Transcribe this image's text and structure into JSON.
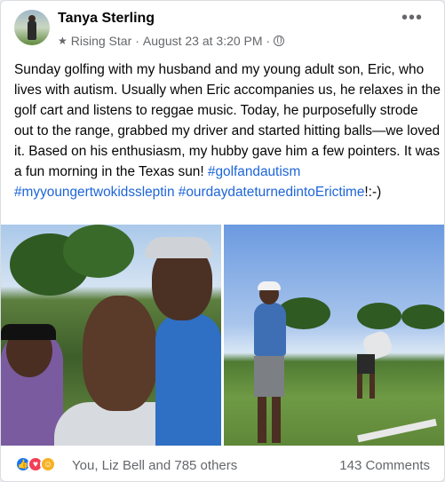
{
  "post": {
    "author": "Tanya Sterling",
    "badge": "Rising Star",
    "timestamp": "August 23 at 3:20 PM",
    "more_label": "•••",
    "body": "Sunday golfing with my husband and my young adult son, Eric, who lives with autism.  Usually when Eric accompanies us, he relaxes in the golf cart and listens to reggae music.  Today, he purposefully strode out to the range, grabbed my driver and started hitting balls—we loved it.  Based on his enthusiasm, my hubby gave him a few pointers.  It was a fun morning in the Texas sun!",
    "hashtags": [
      "#golfandautism",
      "#myyoungertwokidssleptin",
      "#ourdaydateturnedintoErictime"
    ],
    "trailing": "!:-)"
  },
  "footer": {
    "reactions_text": "You, Liz Bell and 785 others",
    "comments_text": "143 Comments"
  },
  "icons": [
    "star-icon",
    "globe-icon",
    "more-icon",
    "like-icon",
    "love-icon",
    "care-icon"
  ],
  "colors": {
    "link": "#1d65d8",
    "muted": "#65676b",
    "like": "#1877f2",
    "love": "#f33e58",
    "care": "#f7b125"
  }
}
